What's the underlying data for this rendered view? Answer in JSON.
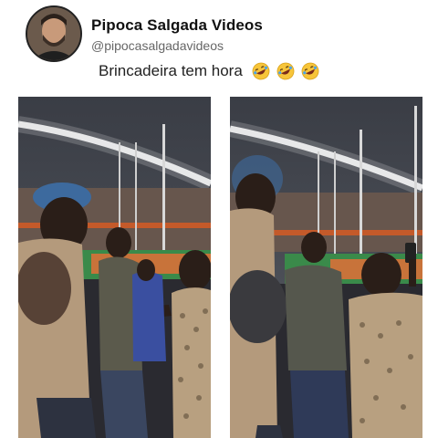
{
  "post": {
    "author_name": "Pipoca Salgada Videos",
    "author_handle": "@pipocasalgadavideos",
    "caption": "Brincadeira tem hora",
    "caption_emojis": [
      "rolling-on-floor-laughing-icon",
      "rolling-on-floor-laughing-icon",
      "rolling-on-floor-laughing-icon"
    ]
  },
  "media": {
    "frames": [
      {
        "description_icon": "stadium-video-frame-1"
      },
      {
        "description_icon": "stadium-video-frame-2"
      }
    ]
  }
}
